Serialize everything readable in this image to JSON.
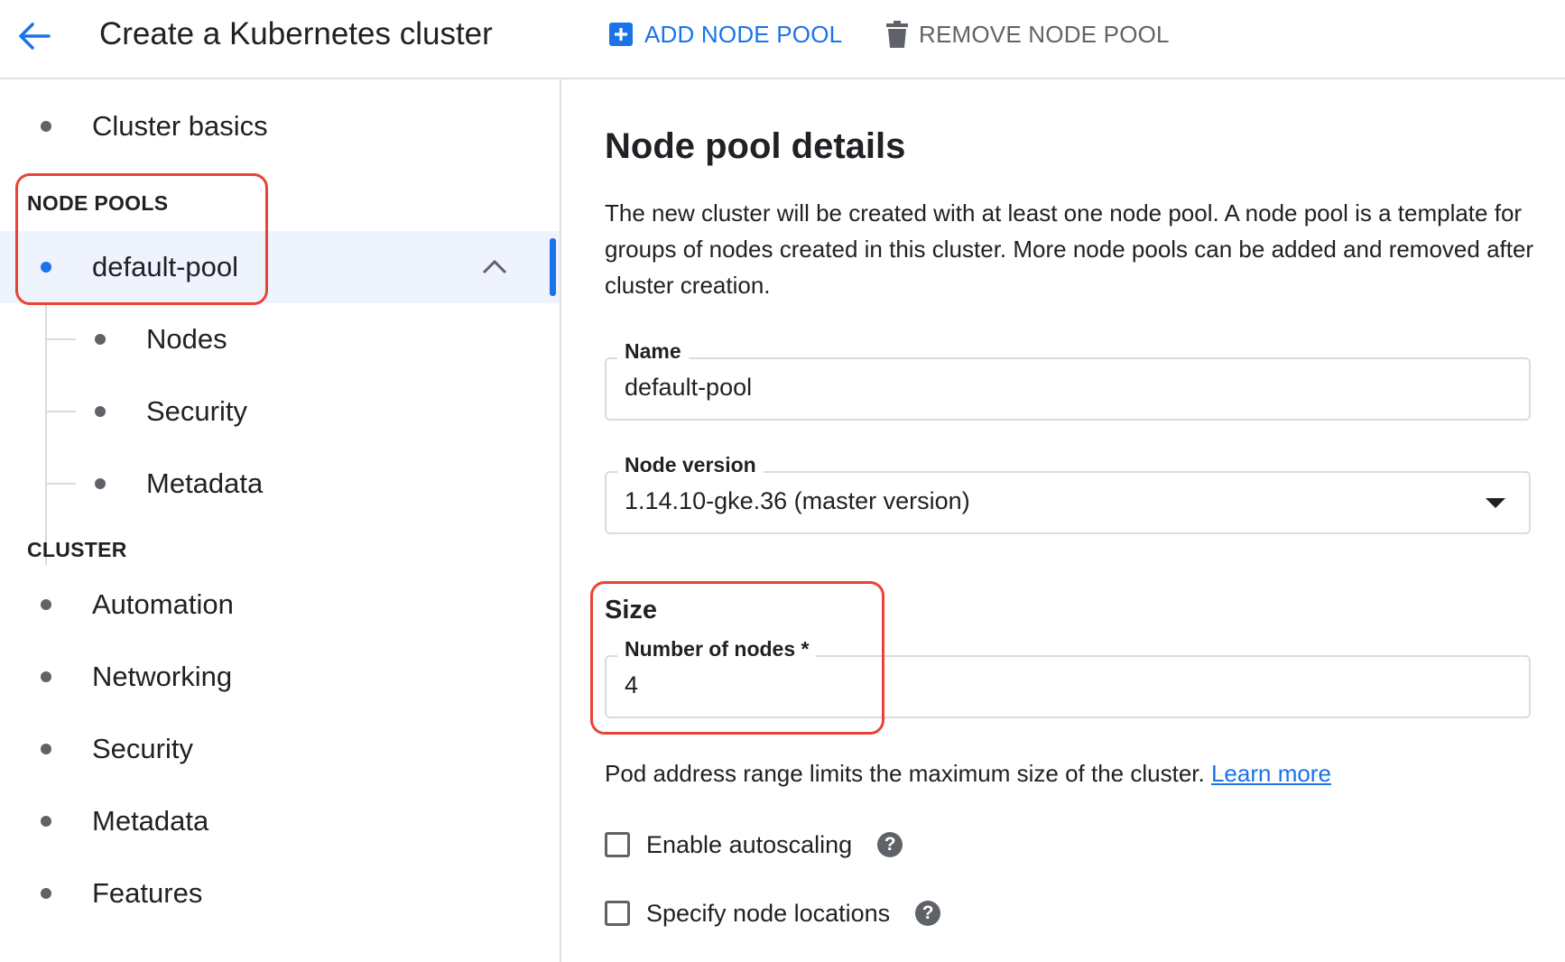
{
  "header": {
    "title": "Create a Kubernetes cluster",
    "add_node_pool": "ADD NODE POOL",
    "remove_node_pool": "REMOVE NODE POOL",
    "accent_color": "#1a73e8"
  },
  "sidebar": {
    "cluster_basics": "Cluster basics",
    "node_pools_heading": "NODE POOLS",
    "default_pool": "default-pool",
    "pool_children": [
      "Nodes",
      "Security",
      "Metadata"
    ],
    "cluster_heading": "CLUSTER",
    "cluster_items": [
      "Automation",
      "Networking",
      "Security",
      "Metadata",
      "Features"
    ]
  },
  "main": {
    "title": "Node pool details",
    "description": "The new cluster will be created with at least one node pool. A node pool is a template for groups of nodes created in this cluster. More node pools can be added and removed after cluster creation.",
    "name_label": "Name",
    "name_value": "default-pool",
    "version_label": "Node version",
    "version_value": "1.14.10-gke.36 (master version)",
    "size_heading": "Size",
    "nodes_label": "Number of nodes *",
    "nodes_value": "4",
    "hint_text": "Pod address range limits the maximum size of the cluster.",
    "learn_more": "Learn more",
    "autoscaling_label": "Enable autoscaling",
    "locations_label": "Specify node locations",
    "help_glyph": "?"
  },
  "highlight_color": "#ea4335"
}
